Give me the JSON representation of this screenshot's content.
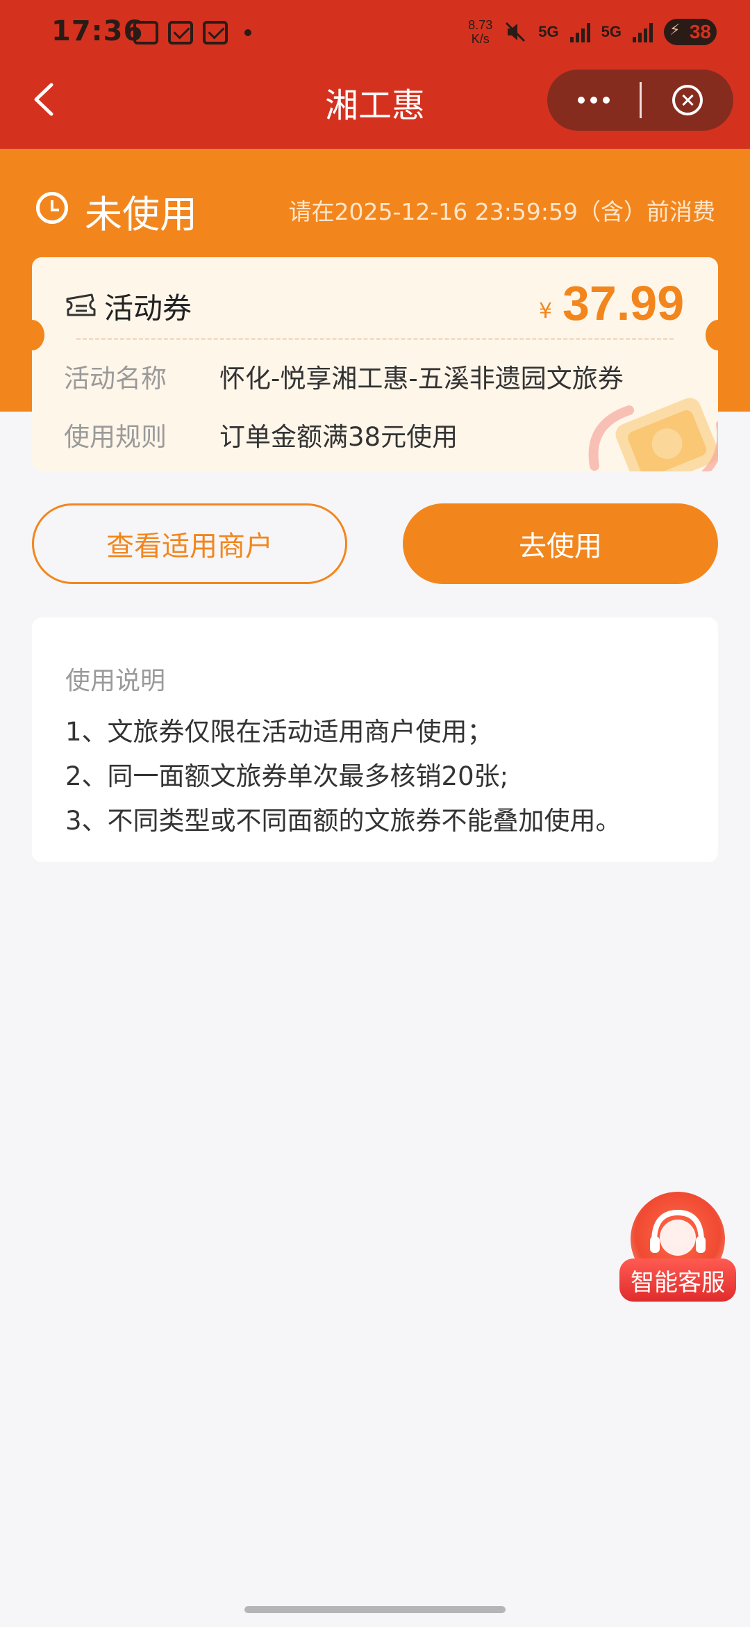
{
  "status_bar": {
    "time": "17:36",
    "net_speed_value": "8.73",
    "net_speed_unit": "K/s",
    "sig1": "5G",
    "sig2": "5G",
    "battery": "38"
  },
  "nav": {
    "title": "湘工惠"
  },
  "coupon": {
    "status": "未使用",
    "deadline": "请在2025-12-16 23:59:59（含）前消费",
    "type_label": "活动券",
    "currency": "¥",
    "amount": "37.99",
    "rows": [
      {
        "label": "活动名称",
        "value": "怀化-悦享湘工惠-五溪非遗园文旅券"
      },
      {
        "label": "使用规则",
        "value": "订单金额满38元使用"
      }
    ]
  },
  "actions": {
    "view_merchants": "查看适用商户",
    "use_now": "去使用"
  },
  "instructions": {
    "title": "使用说明",
    "items": [
      "1、文旅券仅限在活动适用商户使用；",
      "2、同一面额文旅券单次最多核销20张;",
      "3、不同类型或不同面额的文旅券不能叠加使用。"
    ]
  },
  "customer_service": {
    "label": "智能客服"
  },
  "colors": {
    "nav_red": "#d4321f",
    "brand_orange": "#f2861d",
    "card_bg": "#fff6ea"
  }
}
